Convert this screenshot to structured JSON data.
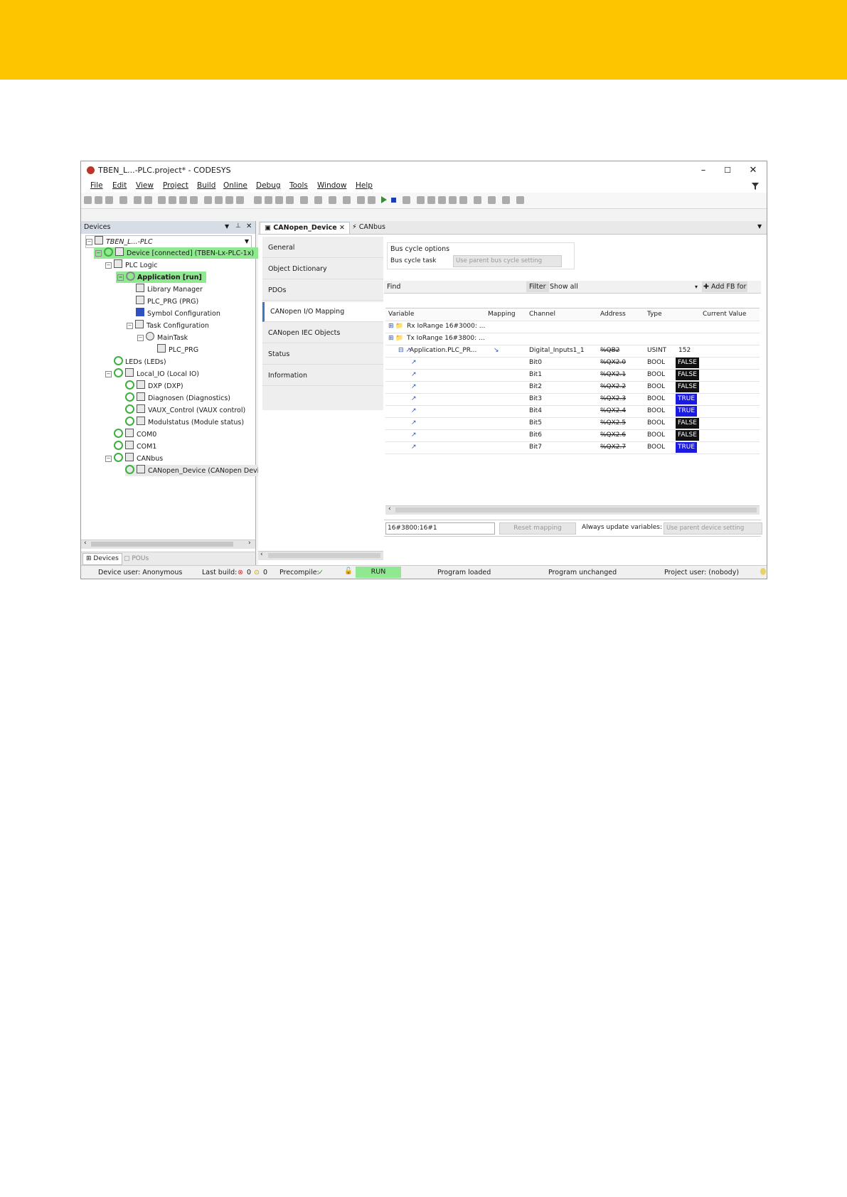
{
  "colors": {
    "banner": "#fcc500",
    "run_green": "#90e890",
    "false_bg": "#111111",
    "true_bg": "#1a1ae0"
  },
  "window": {
    "title": "TBEN_L...-PLC.project* - CODESYS",
    "controls": [
      "–",
      "☐",
      "✕"
    ],
    "filter_icon": "funnel-icon"
  },
  "menu": [
    "File",
    "Edit",
    "View",
    "Project",
    "Build",
    "Online",
    "Debug",
    "Tools",
    "Window",
    "Help"
  ],
  "devices": {
    "title": "Devices",
    "tree": [
      {
        "label": "TBEN_L...-PLC",
        "indent": 0
      },
      {
        "label": "Device [connected] (TBEN-Lx-PLC-1x)",
        "indent": 1
      },
      {
        "label": "PLC Logic",
        "indent": 2
      },
      {
        "label": "Application [run]",
        "indent": 3
      },
      {
        "label": "Library Manager",
        "indent": 4
      },
      {
        "label": "PLC_PRG (PRG)",
        "indent": 4
      },
      {
        "label": "Symbol Configuration",
        "indent": 4
      },
      {
        "label": "Task Configuration",
        "indent": 4
      },
      {
        "label": "MainTask",
        "indent": 5
      },
      {
        "label": "PLC_PRG",
        "indent": 6
      },
      {
        "label": "LEDs (LEDs)",
        "indent": 2
      },
      {
        "label": "Local_IO (Local IO)",
        "indent": 2
      },
      {
        "label": "DXP (DXP)",
        "indent": 3
      },
      {
        "label": "Diagnosen (Diagnostics)",
        "indent": 3
      },
      {
        "label": "VAUX_Control (VAUX control)",
        "indent": 3
      },
      {
        "label": "Modulstatus (Module status)",
        "indent": 3
      },
      {
        "label": "COM0",
        "indent": 2
      },
      {
        "label": "COM1",
        "indent": 2
      },
      {
        "label": "CANbus",
        "indent": 2
      },
      {
        "label": "CANopen_Device (CANopen Device)",
        "indent": 3
      }
    ],
    "bottom_tabs": [
      "Devices",
      "POUs"
    ]
  },
  "editor": {
    "tabs": [
      "CANopen_Device",
      "CANbus"
    ],
    "side_tabs": [
      "General",
      "Object Dictionary",
      "PDOs",
      "CANopen I/O Mapping",
      "CANopen IEC Objects",
      "Status",
      "Information"
    ],
    "bus_cycle": {
      "group": "Bus cycle options",
      "label": "Bus cycle task",
      "value": "Use parent bus cycle setting"
    },
    "find_label": "Find",
    "filter_label": "Filter",
    "filter_value": "Show all",
    "add_fb": "Add FB for",
    "columns": [
      "Variable",
      "Mapping",
      "Channel",
      "Address",
      "Type",
      "Current Value"
    ],
    "rows": [
      {
        "variable": "Rx IoRange 16#3000: ...",
        "channel": "",
        "address": "",
        "type": "",
        "value": ""
      },
      {
        "variable": "Tx IoRange 16#3800: ...",
        "channel": "",
        "address": "",
        "type": "",
        "value": ""
      },
      {
        "variable": "Application.PLC_PR...",
        "channel": "Digital_Inputs1_1",
        "address": "%QB2",
        "type": "USINT",
        "value": "152"
      },
      {
        "variable": "",
        "channel": "Bit0",
        "address": "%QX2.0",
        "type": "BOOL",
        "value": "FALSE"
      },
      {
        "variable": "",
        "channel": "Bit1",
        "address": "%QX2.1",
        "type": "BOOL",
        "value": "FALSE"
      },
      {
        "variable": "",
        "channel": "Bit2",
        "address": "%QX2.2",
        "type": "BOOL",
        "value": "FALSE"
      },
      {
        "variable": "",
        "channel": "Bit3",
        "address": "%QX2.3",
        "type": "BOOL",
        "value": "TRUE"
      },
      {
        "variable": "",
        "channel": "Bit4",
        "address": "%QX2.4",
        "type": "BOOL",
        "value": "TRUE"
      },
      {
        "variable": "",
        "channel": "Bit5",
        "address": "%QX2.5",
        "type": "BOOL",
        "value": "FALSE"
      },
      {
        "variable": "",
        "channel": "Bit6",
        "address": "%QX2.6",
        "type": "BOOL",
        "value": "FALSE"
      },
      {
        "variable": "",
        "channel": "Bit7",
        "address": "%QX2.7",
        "type": "BOOL",
        "value": "TRUE"
      }
    ],
    "index_field": "16#3800:16#1",
    "reset_mapping": "Reset mapping",
    "always_update_label": "Always update variables:",
    "always_update_value": "Use parent device setting"
  },
  "status": {
    "device_user": "Device user: Anonymous",
    "last_build": "Last build:",
    "errors": "0",
    "warnings": "0",
    "precompile": "Precompile:",
    "run": "RUN",
    "program_loaded": "Program loaded",
    "program_unchanged": "Program unchanged",
    "project_user": "Project user: (nobody)"
  }
}
